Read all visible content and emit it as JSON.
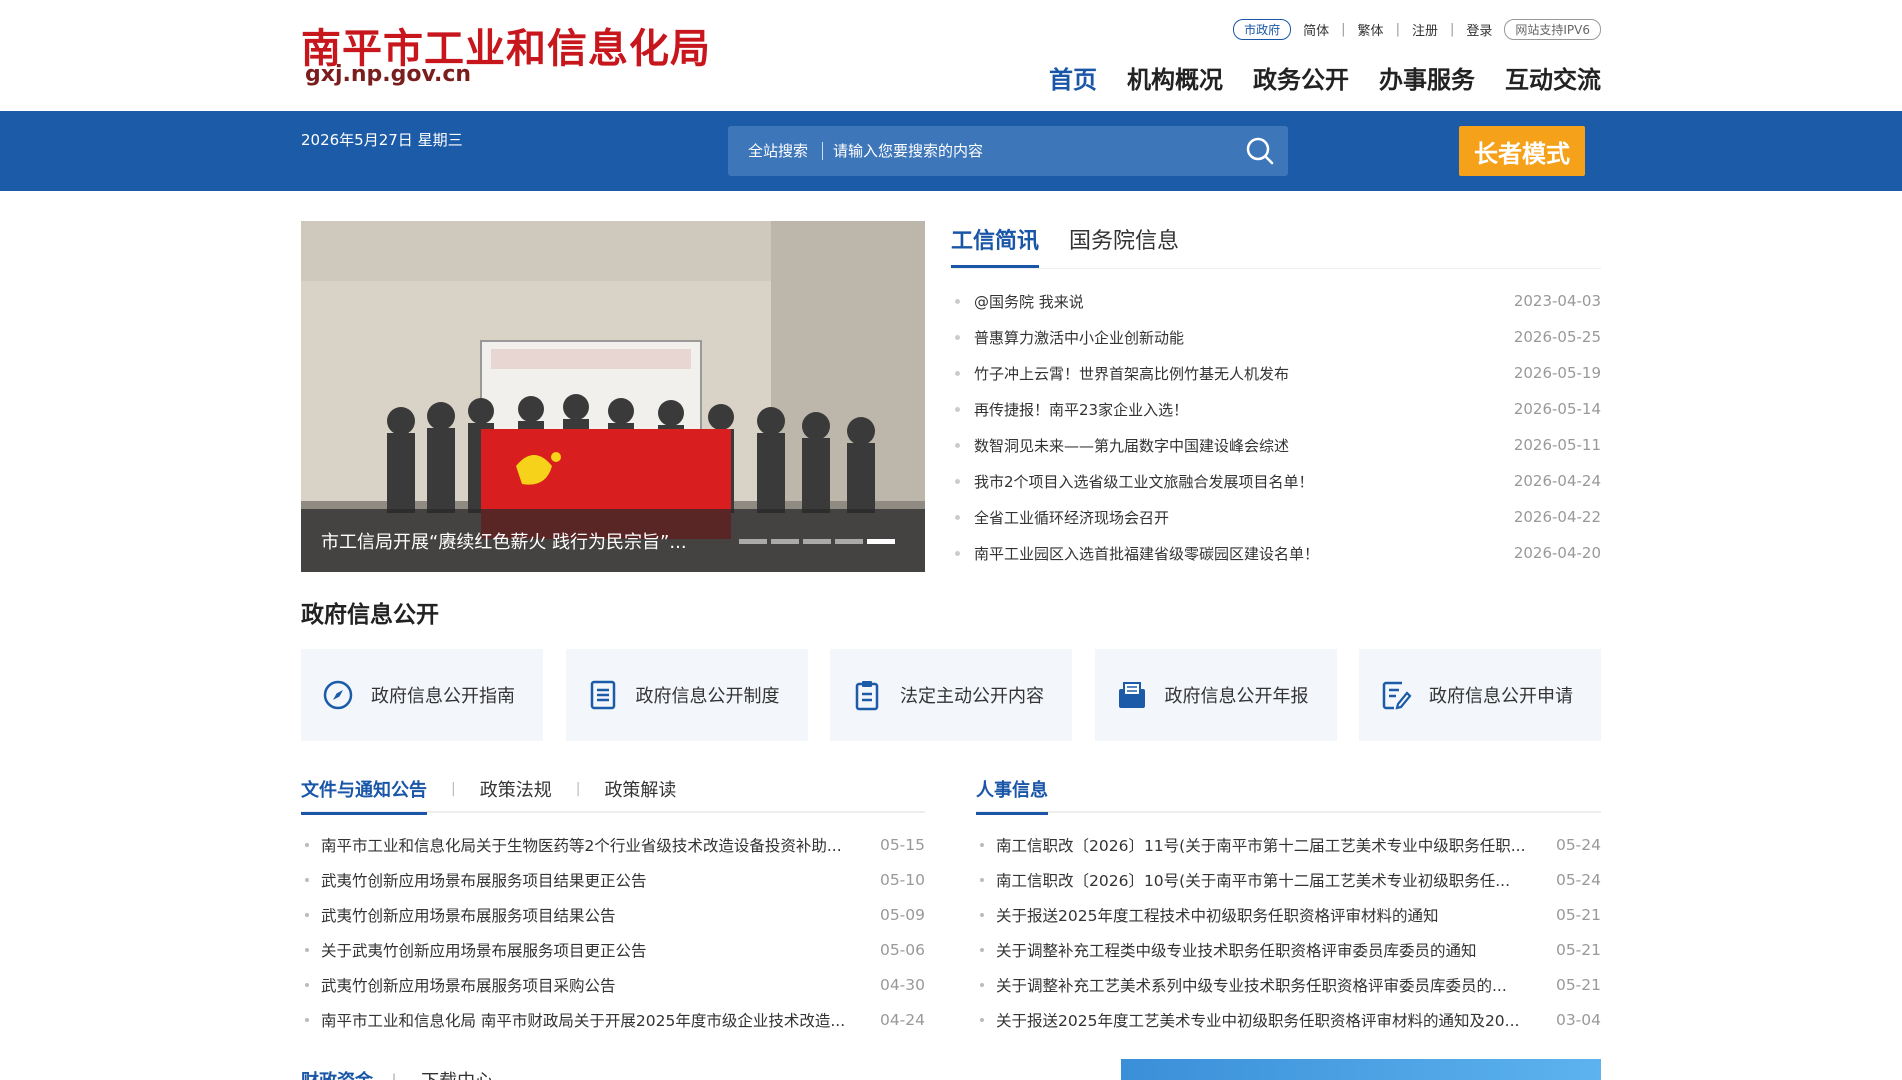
{
  "header": {
    "site_title": "南平市工业和信息化局",
    "domain": "gxj.np.gov.cn",
    "toplinks": {
      "city_gov": "市政府",
      "simplified": "简体",
      "traditional": "繁体",
      "register": "注册",
      "login": "登录",
      "ipv6": "网站支持IPV6"
    },
    "nav": [
      "首页",
      "机构概况",
      "政务公开",
      "办事服务",
      "互动交流"
    ]
  },
  "bar": {
    "date": "2026年5月27日 星期三",
    "search_scope": "全站搜索",
    "search_placeholder": "请输入您要搜索的内容",
    "elder_mode": "长者模式"
  },
  "slider": {
    "caption": "市工信局开展“赓续红色薪火 践行为民宗旨”...",
    "dots_total": 5,
    "active_dot": 5
  },
  "news": {
    "tabs": [
      "工信简讯",
      "国务院信息"
    ],
    "items": [
      {
        "title": "@国务院 我来说",
        "date": "2023-04-03"
      },
      {
        "title": "普惠算力激活中小企业创新动能",
        "date": "2026-05-25"
      },
      {
        "title": "竹子冲上云霄！世界首架高比例竹基无人机发布",
        "date": "2026-05-19"
      },
      {
        "title": "再传捷报！南平23家企业入选！",
        "date": "2026-05-14"
      },
      {
        "title": "数智洞见未来——第九届数字中国建设峰会综述",
        "date": "2026-05-11"
      },
      {
        "title": "我市2个项目入选省级工业文旅融合发展项目名单！",
        "date": "2026-04-24"
      },
      {
        "title": "全省工业循环经济现场会召开",
        "date": "2026-04-22"
      },
      {
        "title": "南平工业园区入选首批福建省级零碳园区建设名单！",
        "date": "2026-04-20"
      }
    ]
  },
  "gov_open": {
    "title": "政府信息公开",
    "cards": [
      {
        "label": "政府信息公开指南",
        "icon": "compass-icon"
      },
      {
        "label": "政府信息公开制度",
        "icon": "document-list-icon"
      },
      {
        "label": "法定主动公开内容",
        "icon": "clipboard-icon"
      },
      {
        "label": "政府信息公开年报",
        "icon": "report-icon"
      },
      {
        "label": "政府信息公开申请",
        "icon": "form-edit-icon"
      }
    ]
  },
  "docs": {
    "tabs": [
      "文件与通知公告",
      "政策法规",
      "政策解读"
    ],
    "items": [
      {
        "title": "南平市工业和信息化局关于生物医药等2个行业省级技术改造设备投资补助...",
        "date": "05-15"
      },
      {
        "title": "武夷竹创新应用场景布展服务项目结果更正公告",
        "date": "05-10"
      },
      {
        "title": "武夷竹创新应用场景布展服务项目结果公告",
        "date": "05-09"
      },
      {
        "title": "关于武夷竹创新应用场景布展服务项目更正公告",
        "date": "05-06"
      },
      {
        "title": "武夷竹创新应用场景布展服务项目采购公告",
        "date": "04-30"
      },
      {
        "title": "南平市工业和信息化局 南平市财政局关于开展2025年度市级企业技术改造...",
        "date": "04-24"
      }
    ]
  },
  "personnel": {
    "tabs": [
      "人事信息"
    ],
    "items": [
      {
        "title": "南工信职改〔2026〕11号(关于南平市第十二届工艺美术专业中级职务任职...",
        "date": "05-24"
      },
      {
        "title": "南工信职改〔2026〕10号(关于南平市第十二届工艺美术专业初级职务任...",
        "date": "05-24"
      },
      {
        "title": "关于报送2025年度工程技术中初级职务任职资格评审材料的通知",
        "date": "05-21"
      },
      {
        "title": "关于调整补充工程类中级专业技术职务任职资格评审委员库委员的通知",
        "date": "05-21"
      },
      {
        "title": "关于调整补充工艺美术系列中级专业技术职务任职资格评审委员库委员的...",
        "date": "05-21"
      },
      {
        "title": "关于报送2025年度工艺美术专业中初级职务任职资格评审材料的通知及20...",
        "date": "03-04"
      }
    ]
  },
  "bottom": {
    "tabs": [
      "财政资金",
      "下载中心"
    ]
  },
  "colors": {
    "primary": "#1c5ba8",
    "title_red": "#c8161d",
    "elder_orange": "#f5a21a"
  }
}
